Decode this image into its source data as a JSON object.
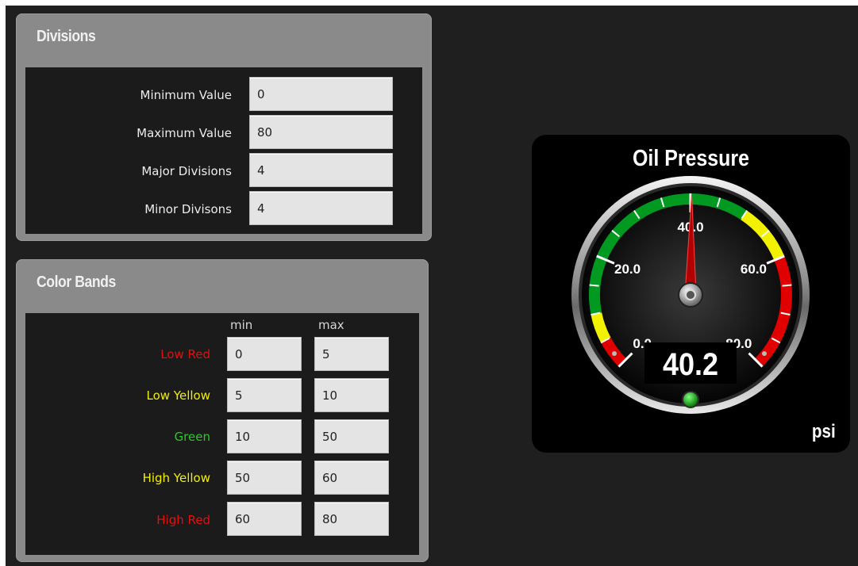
{
  "divisions": {
    "title": "Divisions",
    "rows": [
      {
        "label": "Minimum Value",
        "value": "0"
      },
      {
        "label": "Maximum Value",
        "value": "80"
      },
      {
        "label": "Major Divisions",
        "value": "4"
      },
      {
        "label": "Minor Divisons",
        "value": "4"
      }
    ]
  },
  "color_bands": {
    "title": "Color Bands",
    "min_header": "min",
    "max_header": "max",
    "rows": [
      {
        "label": "Low Red",
        "color": "#e01010",
        "min": "0",
        "max": "5"
      },
      {
        "label": "Low Yellow",
        "color": "#f0f000",
        "min": "5",
        "max": "10"
      },
      {
        "label": "Green",
        "color": "#20d020",
        "min": "10",
        "max": "50"
      },
      {
        "label": "High Yellow",
        "color": "#f0f000",
        "min": "50",
        "max": "60"
      },
      {
        "label": "High Red",
        "color": "#e01010",
        "min": "60",
        "max": "80"
      }
    ]
  },
  "gauge": {
    "title": "Oil Pressure",
    "unit": "psi",
    "reading": "40.2",
    "value": 40.2,
    "min": 0,
    "max": 80,
    "tick_labels": [
      "0.0",
      "20.0",
      "40.0",
      "60.0",
      "80.0"
    ],
    "bands": [
      {
        "from": 0,
        "to": 5,
        "color": "#e00000"
      },
      {
        "from": 5,
        "to": 10,
        "color": "#f2f200"
      },
      {
        "from": 10,
        "to": 50,
        "color": "#009a20"
      },
      {
        "from": 50,
        "to": 60,
        "color": "#f2f200"
      },
      {
        "from": 60,
        "to": 80,
        "color": "#e00000"
      }
    ],
    "needle_color": "#b00000",
    "indicator_color": "#18b018"
  }
}
